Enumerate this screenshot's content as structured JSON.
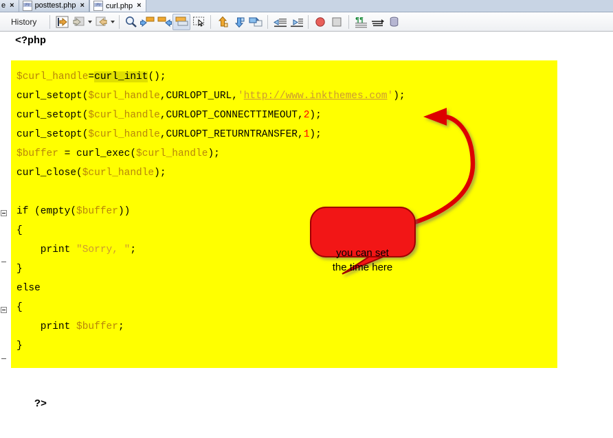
{
  "tabs": [
    {
      "label": "e",
      "icon": "php-file-icon",
      "close": "×",
      "active": false,
      "partial": true
    },
    {
      "label": "posttest.php",
      "icon": "php-file-icon",
      "close": "×",
      "active": false,
      "partial": false
    },
    {
      "label": "curl.php",
      "icon": "php-file-icon",
      "close": "×",
      "active": true,
      "partial": false
    }
  ],
  "toolbar": {
    "history_label": "History",
    "buttons": [
      {
        "name": "last-edit-location-icon",
        "glyph": "⇦"
      },
      {
        "name": "back-icon",
        "glyph": "⇦"
      },
      {
        "name": "back-dropdown-caret-icon",
        "glyph": "▾"
      },
      {
        "name": "forward-icon",
        "glyph": "⇨"
      },
      {
        "name": "forward-dropdown-caret-icon",
        "glyph": "▾"
      },
      {
        "name": "find-icon",
        "glyph": "🔍"
      },
      {
        "name": "previous-bookmark-icon",
        "glyph": "←"
      },
      {
        "name": "next-bookmark-icon",
        "glyph": "→"
      },
      {
        "name": "toggle-split-view-icon",
        "glyph": "▤"
      },
      {
        "name": "rectangular-selection-icon",
        "glyph": "⬚"
      },
      {
        "name": "move-up-icon",
        "glyph": "↑"
      },
      {
        "name": "move-down-icon",
        "glyph": "↓"
      },
      {
        "name": "duplicate-icon",
        "glyph": "⧉"
      },
      {
        "name": "unindent-icon",
        "glyph": "⇤"
      },
      {
        "name": "indent-icon",
        "glyph": "⇥"
      },
      {
        "name": "record-macro-icon",
        "glyph": "●"
      },
      {
        "name": "stop-macro-icon",
        "glyph": "■"
      },
      {
        "name": "show-whitespace-icon",
        "glyph": "¶"
      },
      {
        "name": "word-wrap-icon",
        "glyph": "≡"
      },
      {
        "name": "database-icon",
        "glyph": "⛁"
      }
    ]
  },
  "editor": {
    "php_open_tag": "<?php",
    "php_close_tag": "?>",
    "code_lines": [
      {
        "segments": [
          {
            "t": "$curl_handle",
            "c": "var"
          },
          {
            "t": "=",
            "c": ""
          },
          {
            "t": "curl_init",
            "c": "hl"
          },
          {
            "t": "();",
            "c": ""
          }
        ]
      },
      {
        "segments": [
          {
            "t": "curl_setopt(",
            "c": ""
          },
          {
            "t": "$curl_handle",
            "c": "var"
          },
          {
            "t": ",CURLOPT_URL,",
            "c": ""
          },
          {
            "t": "'",
            "c": "str"
          },
          {
            "t": "http://www.inkthemes.com",
            "c": "url"
          },
          {
            "t": "'",
            "c": "str"
          },
          {
            "t": ");",
            "c": ""
          }
        ]
      },
      {
        "segments": [
          {
            "t": "curl_setopt(",
            "c": ""
          },
          {
            "t": "$curl_handle",
            "c": "var"
          },
          {
            "t": ",CURLOPT_CONNECTTIMEOUT,",
            "c": ""
          },
          {
            "t": "2",
            "c": "num"
          },
          {
            "t": ");",
            "c": ""
          }
        ]
      },
      {
        "segments": [
          {
            "t": "curl_setopt(",
            "c": ""
          },
          {
            "t": "$curl_handle",
            "c": "var"
          },
          {
            "t": ",CURLOPT_RETURNTRANSFER,",
            "c": ""
          },
          {
            "t": "1",
            "c": "num"
          },
          {
            "t": ");",
            "c": ""
          }
        ]
      },
      {
        "segments": [
          {
            "t": "$buffer",
            "c": "var"
          },
          {
            "t": " = curl_exec(",
            "c": ""
          },
          {
            "t": "$curl_handle",
            "c": "var"
          },
          {
            "t": ");",
            "c": ""
          }
        ]
      },
      {
        "segments": [
          {
            "t": "curl_close(",
            "c": ""
          },
          {
            "t": "$curl_handle",
            "c": "var"
          },
          {
            "t": ");",
            "c": ""
          }
        ]
      },
      {
        "segments": [
          {
            "t": "",
            "c": ""
          }
        ]
      },
      {
        "segments": [
          {
            "t": "if (empty(",
            "c": ""
          },
          {
            "t": "$buffer",
            "c": "var"
          },
          {
            "t": "))",
            "c": ""
          }
        ]
      },
      {
        "segments": [
          {
            "t": "{",
            "c": ""
          }
        ]
      },
      {
        "segments": [
          {
            "t": "    print ",
            "c": ""
          },
          {
            "t": "\"Sorry, \"",
            "c": "str"
          },
          {
            "t": ";",
            "c": ""
          }
        ]
      },
      {
        "segments": [
          {
            "t": "}",
            "c": ""
          }
        ]
      },
      {
        "segments": [
          {
            "t": "else",
            "c": ""
          }
        ]
      },
      {
        "segments": [
          {
            "t": "{",
            "c": ""
          }
        ]
      },
      {
        "segments": [
          {
            "t": "    print ",
            "c": ""
          },
          {
            "t": "$buffer",
            "c": "var"
          },
          {
            "t": ";",
            "c": ""
          }
        ]
      },
      {
        "segments": [
          {
            "t": "}",
            "c": ""
          }
        ]
      }
    ]
  },
  "annotation": {
    "callout_line1": "you can set",
    "callout_line2": "the time here",
    "callout_color": "#ee0000",
    "callout_border_color": "#aa0000",
    "arrow_color": "#dd0000"
  },
  "colors": {
    "code_background": "#ffff00",
    "variable": "#b8860b",
    "string": "#cc9933",
    "number": "#ff0000",
    "highlight": "#e0e000",
    "tab_bar": "#c8d4e4"
  }
}
